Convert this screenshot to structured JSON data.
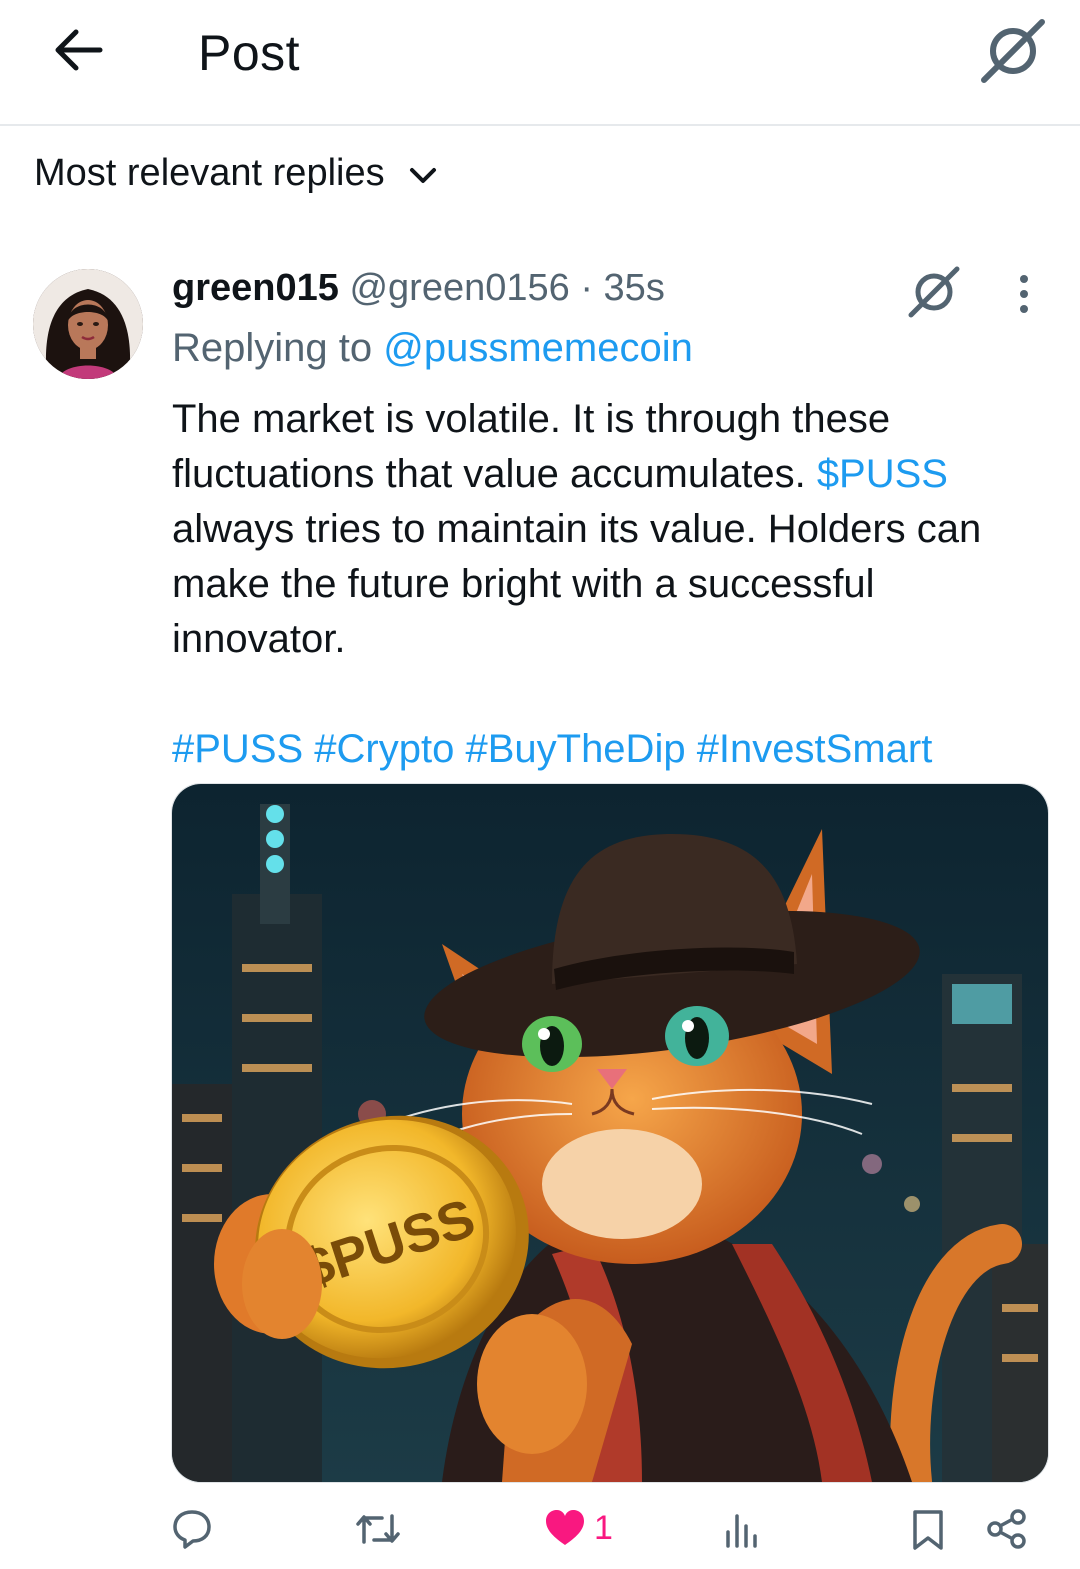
{
  "header": {
    "title": "Post",
    "back_icon": "arrow-left-icon",
    "grok_icon": "grok-icon"
  },
  "sort": {
    "label": "Most relevant replies",
    "icon": "chevron-down-icon"
  },
  "reply": {
    "display_name": "green015",
    "handle": "@green0156",
    "separator": " · ",
    "time": "35s",
    "replying_prefix": "Replying to ",
    "replying_to": "@pussmemecoin",
    "text_part1": "The market is volatile. It is through these fluctuations that value accumulates. ",
    "cashtag": "$PUSS",
    "text_part2": " always tries to maintain its value. Holders can make the future bright with a successful innovator.",
    "hashtags": "#PUSS #Crypto #BuyTheDip #InvestSmart",
    "media": {
      "coin_text": "$PUSS"
    }
  },
  "actions": {
    "reply_icon": "comment-icon",
    "repost_icon": "repost-icon",
    "like_icon": "heart-icon",
    "like_count": "1",
    "views_icon": "views-icon",
    "bookmark_icon": "bookmark-icon",
    "share_icon": "share-icon"
  },
  "colors": {
    "link": "#1d9bf0",
    "like": "#f91880",
    "muted": "#536471"
  }
}
